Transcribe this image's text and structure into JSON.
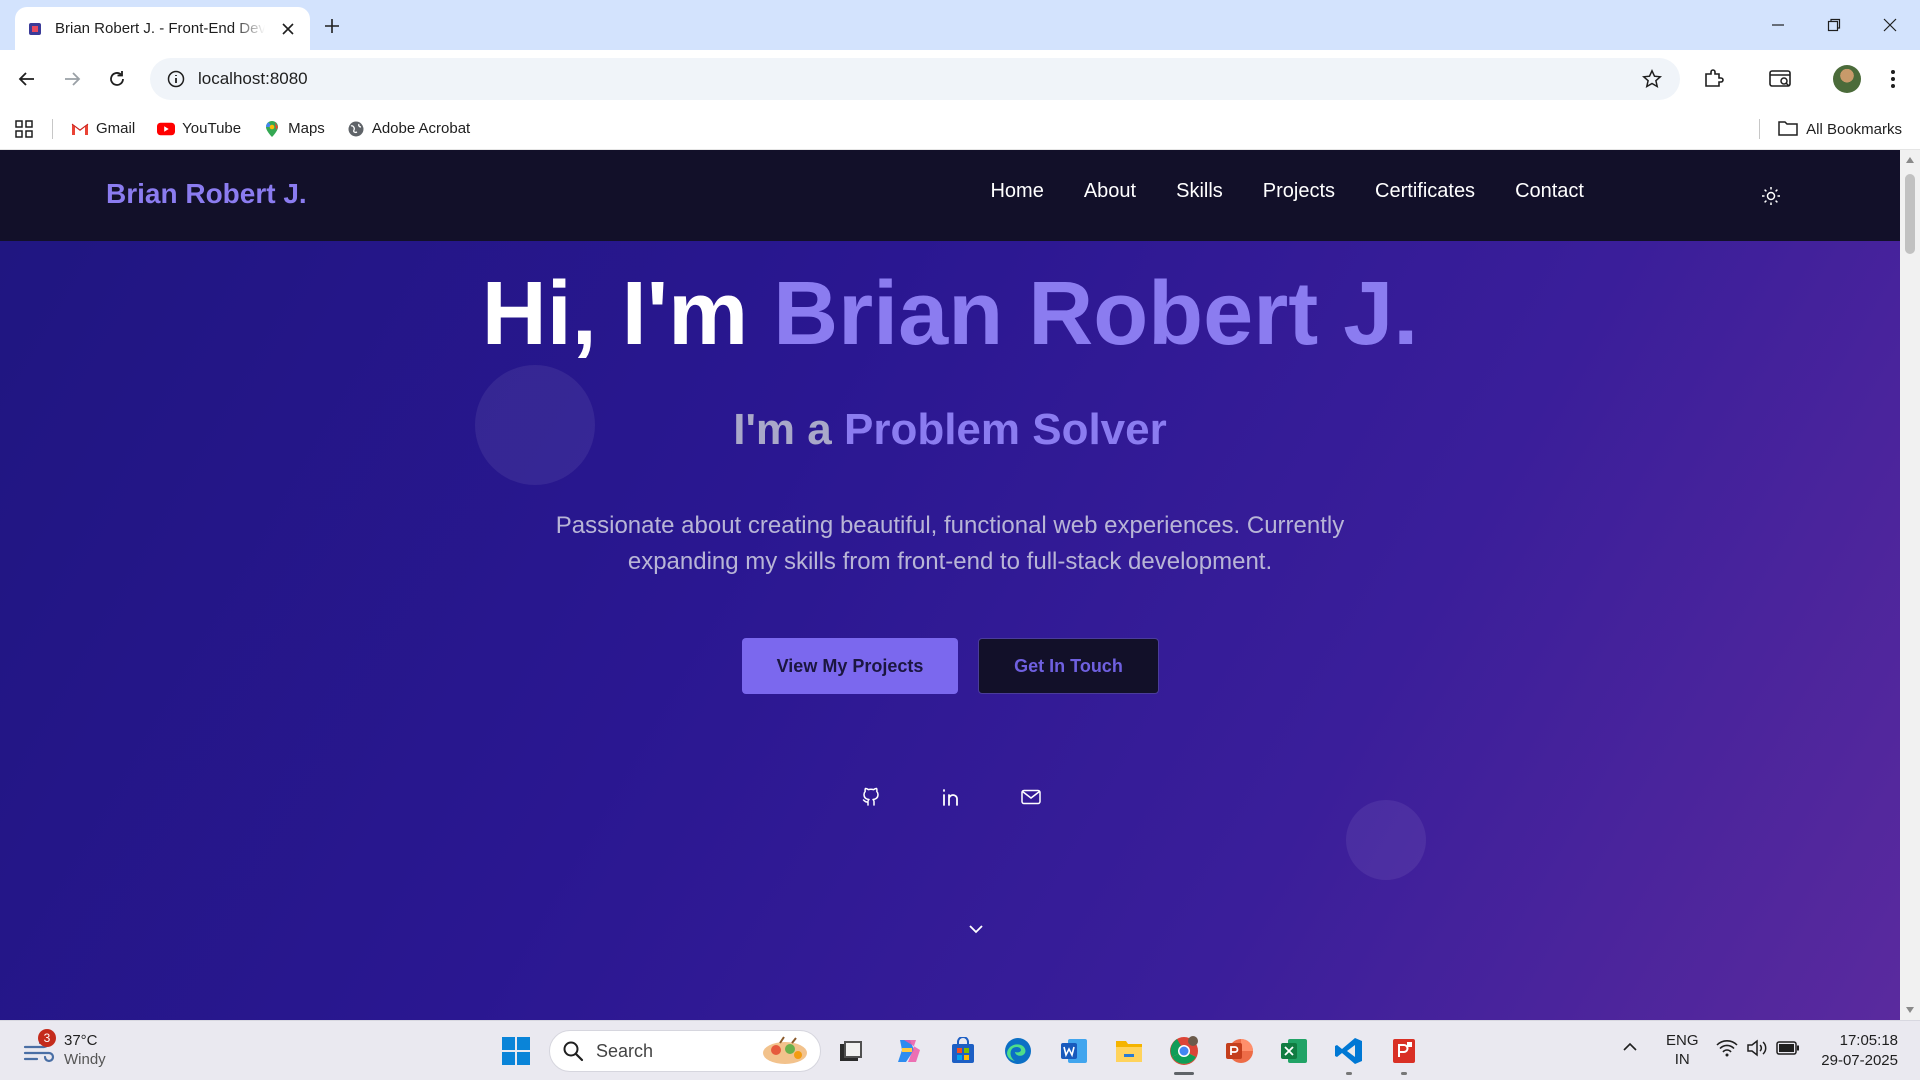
{
  "browser": {
    "tab_title": "Brian Robert J. - Front-End Developer",
    "url": "localhost:8080",
    "bookmarks": [
      {
        "label": "Gmail"
      },
      {
        "label": "YouTube"
      },
      {
        "label": "Maps"
      },
      {
        "label": "Adobe Acrobat"
      }
    ],
    "all_bookmarks_label": "All Bookmarks"
  },
  "site": {
    "logo": "Brian Robert J.",
    "nav": [
      "Home",
      "About",
      "Skills",
      "Projects",
      "Certificates",
      "Contact"
    ],
    "hero": {
      "greeting": "Hi, I'm ",
      "name": "Brian Robert J.",
      "role_prefix": "I'm a ",
      "role": "Problem Solver",
      "description": "Passionate about creating beautiful, functional web experiences. Currently expanding my skills from front-end to full-stack development.",
      "primary_button": "View My Projects",
      "secondary_button": "Get In Touch"
    },
    "colors": {
      "accent": "#8b7cf0",
      "nav_bg": "#121029",
      "button_primary": "#7b68ee"
    }
  },
  "taskbar": {
    "weather_temp": "37°C",
    "weather_desc": "Windy",
    "weather_badge": "3",
    "search_label": "Search",
    "lang": "ENG",
    "region": "IN",
    "time": "17:05:18",
    "date": "29-07-2025"
  }
}
